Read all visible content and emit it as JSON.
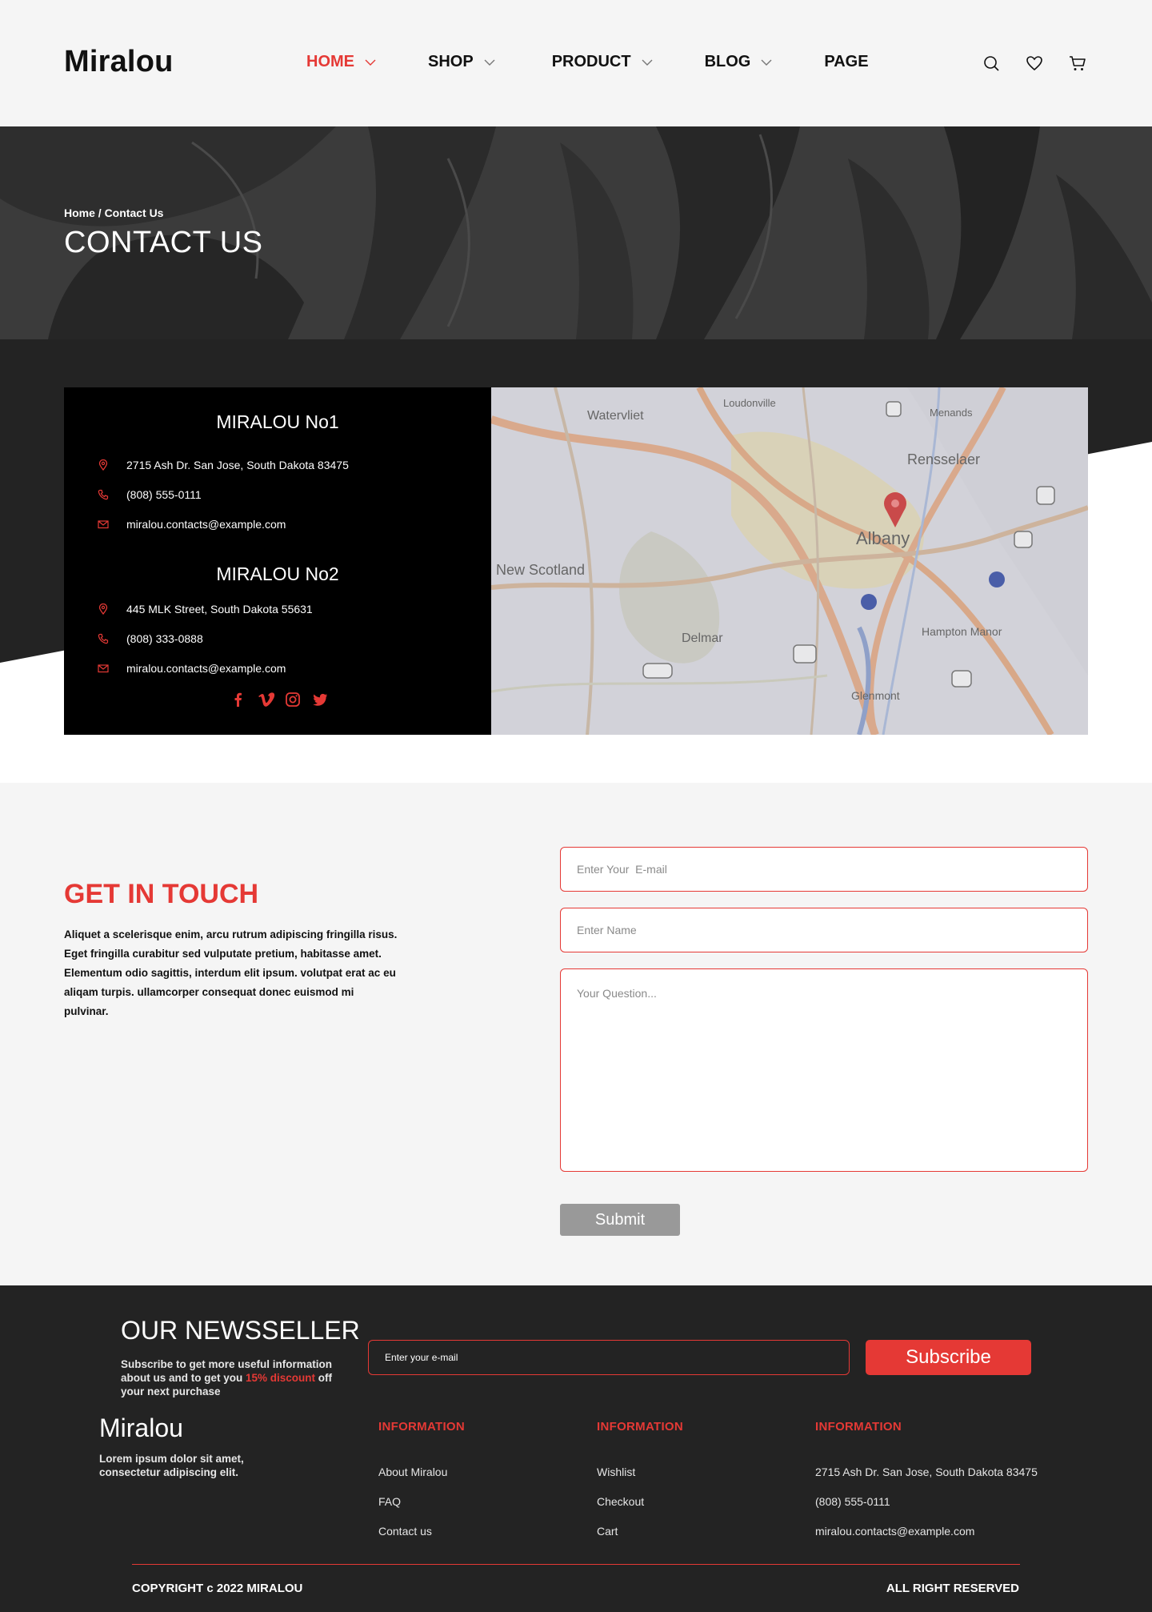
{
  "header": {
    "logo": "Miralou",
    "nav": [
      {
        "label": "HOME",
        "active": true,
        "has_dropdown": true
      },
      {
        "label": "SHOP",
        "active": false,
        "has_dropdown": true
      },
      {
        "label": "PRODUCT",
        "active": false,
        "has_dropdown": true
      },
      {
        "label": "BLOG",
        "active": false,
        "has_dropdown": true
      },
      {
        "label": "PAGE",
        "active": false,
        "has_dropdown": false
      }
    ],
    "icons": [
      "search-icon",
      "heart-icon",
      "cart-icon"
    ]
  },
  "hero": {
    "breadcrumb": "Home / Contact Us",
    "title": "CONTACT US"
  },
  "locations": [
    {
      "title": "MIRALOU No1",
      "address": "2715 Ash Dr. San Jose, South Dakota 83475",
      "phone": "(808) 555-0111",
      "email": "miralou.contacts@example.com"
    },
    {
      "title": "MIRALOU No2",
      "address": "445 MLK Street, South Dakota 55631",
      "phone": "(808) 333-0888",
      "email": "miralou.contacts@example.com"
    }
  ],
  "socials": [
    "facebook-icon",
    "vimeo-icon",
    "instagram-icon",
    "twitter-icon"
  ],
  "map": {
    "labels": [
      "Watervliet",
      "Loudonville",
      "Menands",
      "Rensselaer",
      "Albany",
      "New Scotland",
      "Delmar",
      "Glenmont",
      "Hampton Manor"
    ]
  },
  "touch": {
    "title": "GET IN TOUCH",
    "text": "Aliquet a scelerisque enim, arcu rutrum adipiscing fringilla risus. Eget fringilla curabitur sed vulputate pretium, habitasse amet. Elementum odio sagittis, interdum elit ipsum. volutpat erat ac eu aliqam turpis. ullamcorper consequat donec euismod mi pulvinar.",
    "email_placeholder": "Enter Your  E-mail",
    "name_placeholder": "Enter Name",
    "question_placeholder": "Your Question...",
    "submit_label": "Submit"
  },
  "footer": {
    "news_title": "OUR NEWSSELLER",
    "news_text_1": "Subscribe to get more useful information about us and to get you ",
    "news_accent": "15% discount",
    "news_text_2": " off your next purchase",
    "news_placeholder": "Enter your e-mail",
    "subscribe_label": "Subscribe",
    "logo": "Miralou",
    "desc": "Lorem ipsum dolor sit amet, consectetur adipiscing elit.",
    "columns": [
      {
        "title": "INFORMATION",
        "items": [
          "About Miralou",
          "FAQ",
          "Contact us"
        ]
      },
      {
        "title": "INFORMATION",
        "items": [
          "Wishlist",
          "Checkout",
          "Cart"
        ]
      },
      {
        "title": "INFORMATION",
        "items": [
          "2715 Ash Dr. San Jose, South Dakota 83475",
          "(808) 555-0111",
          "miralou.contacts@example.com"
        ]
      }
    ],
    "copyright": "COPYRIGHT c 2022 MIRALOU",
    "rights": "ALL RIGHT RESERVED"
  },
  "colors": {
    "accent": "#e53935",
    "dark": "#232323",
    "light_bg": "#f5f5f5"
  }
}
